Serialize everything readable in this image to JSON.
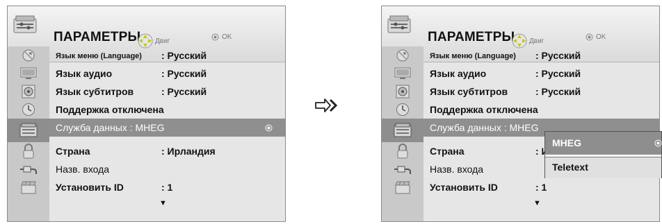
{
  "title": "ПАРАМЕТРЫ",
  "move_hint": "Двиг",
  "ok_hint": "OK",
  "sidebar_icons": [
    "satellite-dish-icon",
    "monitor-icon",
    "speaker-icon",
    "clock-icon",
    "options-icon",
    "lock-icon",
    "input-plug-icon",
    "clapperboard-icon"
  ],
  "left": {
    "rows": [
      {
        "label": "Язык меню (Language)",
        "value": ": Русский"
      },
      {
        "label": "Язык аудио",
        "value": ": Русский"
      },
      {
        "label": "Язык субтитров",
        "value": ": Русский"
      },
      {
        "label": "Поддержка отключена",
        "value": ""
      },
      {
        "label": "Служба данных : MHEG",
        "value": ""
      },
      {
        "label": "Страна",
        "value": ": Ирландия"
      },
      {
        "label": "Назв. входа",
        "value": ""
      },
      {
        "label": "Установить ID",
        "value": ": 1"
      }
    ]
  },
  "right": {
    "rows": [
      {
        "label": "Язык меню (Language)",
        "value": ": Русский"
      },
      {
        "label": "Язык аудио",
        "value": ": Русский"
      },
      {
        "label": "Язык субтитров",
        "value": ": Русский"
      },
      {
        "label": "Поддержка отключена",
        "value": ""
      },
      {
        "label": "Служба данных : MHEG",
        "value": ""
      },
      {
        "label": "Страна",
        "value": ": Ирландия"
      },
      {
        "label": "Назв. входа",
        "value": ""
      },
      {
        "label": "Установить ID",
        "value": ": 1"
      }
    ],
    "popup": {
      "options": [
        "MHEG",
        "Teletext"
      ],
      "selected": "MHEG"
    }
  },
  "colors": {
    "highlight": "#8e8e8e",
    "panel": "#e6e6e6",
    "sidebar": "#c9c9c9"
  }
}
